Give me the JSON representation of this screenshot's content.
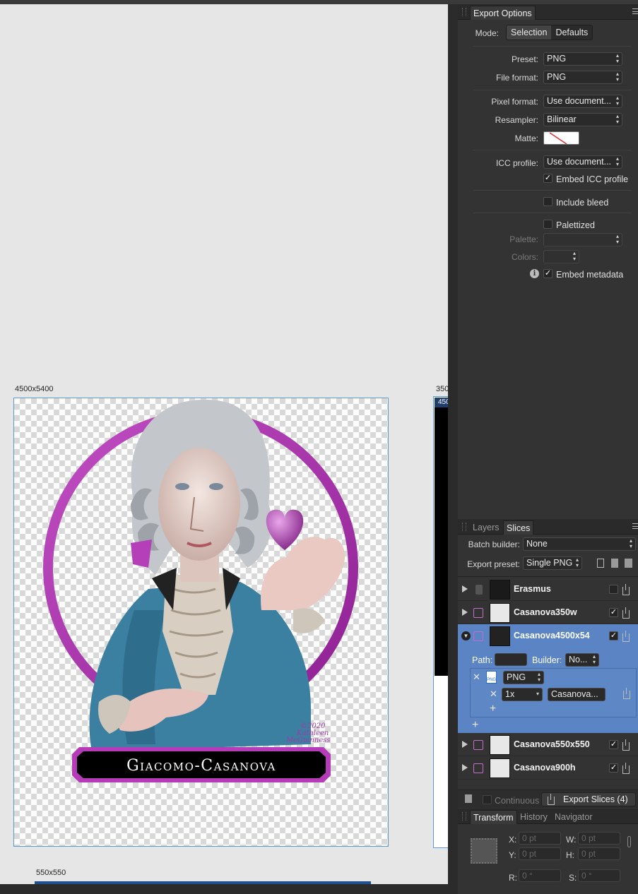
{
  "canvas": {
    "artboard_main_label": "4500x5400",
    "artboard_side_label": "350",
    "artboard_side_inner_label": "450",
    "artboard_bottom_label": "550x550",
    "artwork": {
      "nameplate_text": "Giacomo-Casanova",
      "signature_line1": "©2020",
      "signature_line2": "Kathleen",
      "signature_line3": "McGuinness",
      "ring_color": "#b63bb8",
      "coat_color": "#3a7fa0"
    }
  },
  "export_options": {
    "tab_label": "Export Options",
    "mode_label": "Mode:",
    "mode_options": [
      "Selection",
      "Defaults"
    ],
    "preset_label": "Preset:",
    "preset_value": "PNG",
    "file_format_label": "File format:",
    "file_format_value": "PNG",
    "pixel_format_label": "Pixel format:",
    "pixel_format_value": "Use document...",
    "resampler_label": "Resampler:",
    "resampler_value": "Bilinear",
    "matte_label": "Matte:",
    "icc_profile_label": "ICC profile:",
    "icc_profile_value": "Use document...",
    "embed_icc_label": "Embed ICC profile",
    "embed_icc_checked": "✓",
    "include_bleed_label": "Include bleed",
    "palettized_label": "Palettized",
    "palette_label": "Palette:",
    "colors_label": "Colors:",
    "embed_metadata_label": "Embed metadata",
    "embed_metadata_checked": "✓",
    "info_glyph": "i"
  },
  "slices_panel": {
    "tabs": [
      "Layers",
      "Slices"
    ],
    "batch_builder_label": "Batch builder:",
    "batch_builder_value": "None",
    "export_preset_label": "Export preset:",
    "export_preset_value": "Single PNG",
    "rows": [
      {
        "name": "Erasmus",
        "checked": ""
      },
      {
        "name": "Casanova350w",
        "checked": "✓"
      },
      {
        "name": "Casanova4500x54",
        "checked": "✓"
      },
      {
        "name": "Casanova550x550",
        "checked": "✓"
      },
      {
        "name": "Casanova900h",
        "checked": "✓"
      }
    ],
    "path_label": "Path:",
    "builder_label": "Builder:",
    "builder_value": "No...",
    "format_value": "PNG",
    "format_icon_text": "PNG",
    "scale_value": "1x",
    "filename_value": "Casanova...",
    "continuous_label": "Continuous",
    "export_slices_label": "Export Slices (4)"
  },
  "transform_panel": {
    "tabs": [
      "Transform",
      "History",
      "Navigator"
    ],
    "x_label": "X:",
    "x_value": "0 pt",
    "y_label": "Y:",
    "y_value": "0 pt",
    "w_label": "W:",
    "w_value": "0 pt",
    "h_label": "H:",
    "h_value": "0 pt",
    "r_label": "R:",
    "r_value": "0 °",
    "s_label": "S:",
    "s_value": "0 °"
  }
}
